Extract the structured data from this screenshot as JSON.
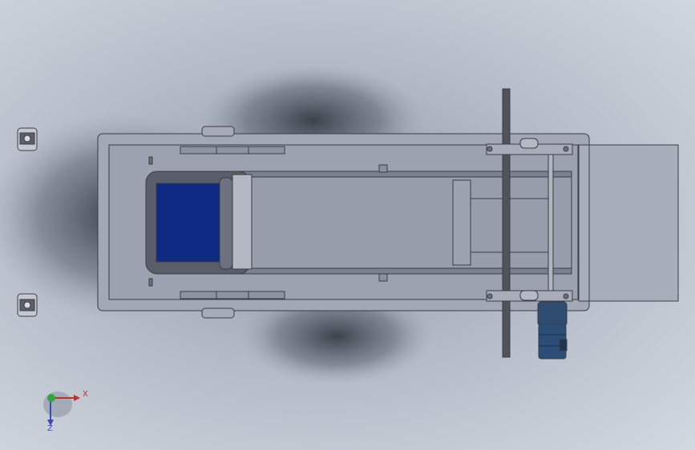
{
  "viewport": {
    "background_top": "#d3d9e1",
    "background_center": "#8f98a6"
  },
  "model": {
    "frame_color": "#9fa4b2",
    "belt_color": "#0f2a82",
    "motor_color": "#2a4e78",
    "edge_color": "#3a3d44"
  },
  "triad": {
    "x_label": "X",
    "z_label": "Z",
    "x_color": "#c2302c",
    "y_color": "#2ea83a",
    "z_color": "#3a4bb8"
  }
}
